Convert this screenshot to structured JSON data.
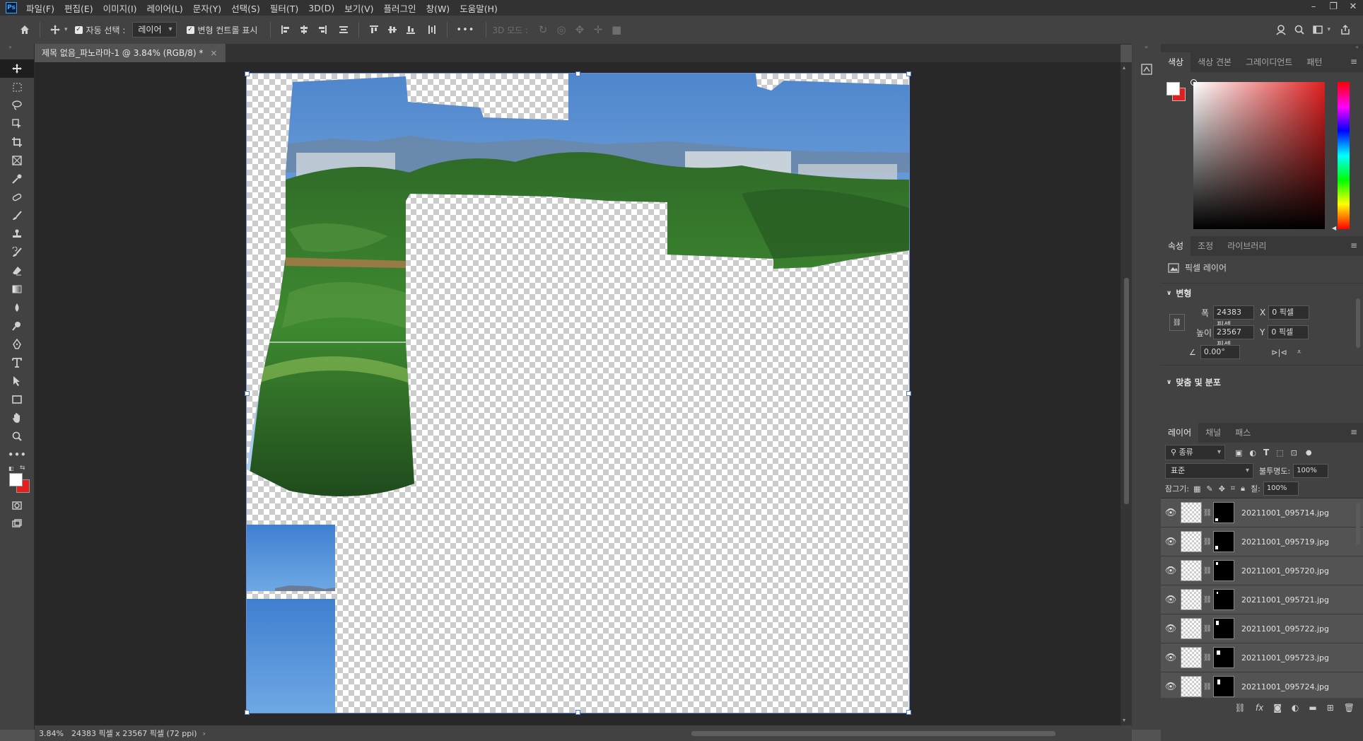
{
  "app": {
    "logo": "Ps"
  },
  "menu": [
    "파일(F)",
    "편집(E)",
    "이미지(I)",
    "레이어(L)",
    "문자(Y)",
    "선택(S)",
    "필터(T)",
    "3D(D)",
    "보기(V)",
    "플러그인",
    "창(W)",
    "도움말(H)"
  ],
  "window_controls": [
    "–",
    "❐",
    "✕"
  ],
  "options": {
    "auto_select_label": "자동 선택 :",
    "auto_select_value": "레이어",
    "transform_label": "변형 컨트롤 표시",
    "mode_3d_label": "3D 모드 :",
    "more": "•••"
  },
  "document": {
    "tab_title": "제목 없음_파노라마-1 @ 3.84% (RGB/8) *",
    "close": "×"
  },
  "status": {
    "zoom": "3.84%",
    "dimensions": "24383 픽셀 x 23567 픽셀 (72 ppi)",
    "arrow": "›"
  },
  "color_panel": {
    "tabs": [
      "색상",
      "색상 견본",
      "그레이디언트",
      "패턴"
    ],
    "foreground": "#ffffff",
    "background": "#e0201e"
  },
  "properties_panel": {
    "tabs": [
      "속성",
      "조정",
      "라이브러리"
    ],
    "layer_type": "픽셀 레이어",
    "transform_section": "변형",
    "width_label": "폭",
    "width_value": "24383 픽셀",
    "height_label": "높이",
    "height_value": "23567 픽셀",
    "x_label": "X",
    "x_value": "0 픽셀",
    "y_label": "Y",
    "y_value": "0 픽셀",
    "angle_value": "0.00°",
    "align_section": "맞춤 및 분포"
  },
  "layers_panel": {
    "tabs": [
      "레이어",
      "채널",
      "패스"
    ],
    "filter_label": "종류",
    "blend_mode": "표준",
    "opacity_label": "불투명도:",
    "opacity_value": "100%",
    "lock_label": "잠그기:",
    "fill_label": "칠:",
    "fill_value": "100%",
    "layers": [
      {
        "name": "20211001_095714.jpg"
      },
      {
        "name": "20211001_095719.jpg"
      },
      {
        "name": "20211001_095720.jpg"
      },
      {
        "name": "20211001_095721.jpg"
      },
      {
        "name": "20211001_095722.jpg"
      },
      {
        "name": "20211001_095723.jpg"
      },
      {
        "name": "20211001_095724.jpg"
      }
    ]
  }
}
